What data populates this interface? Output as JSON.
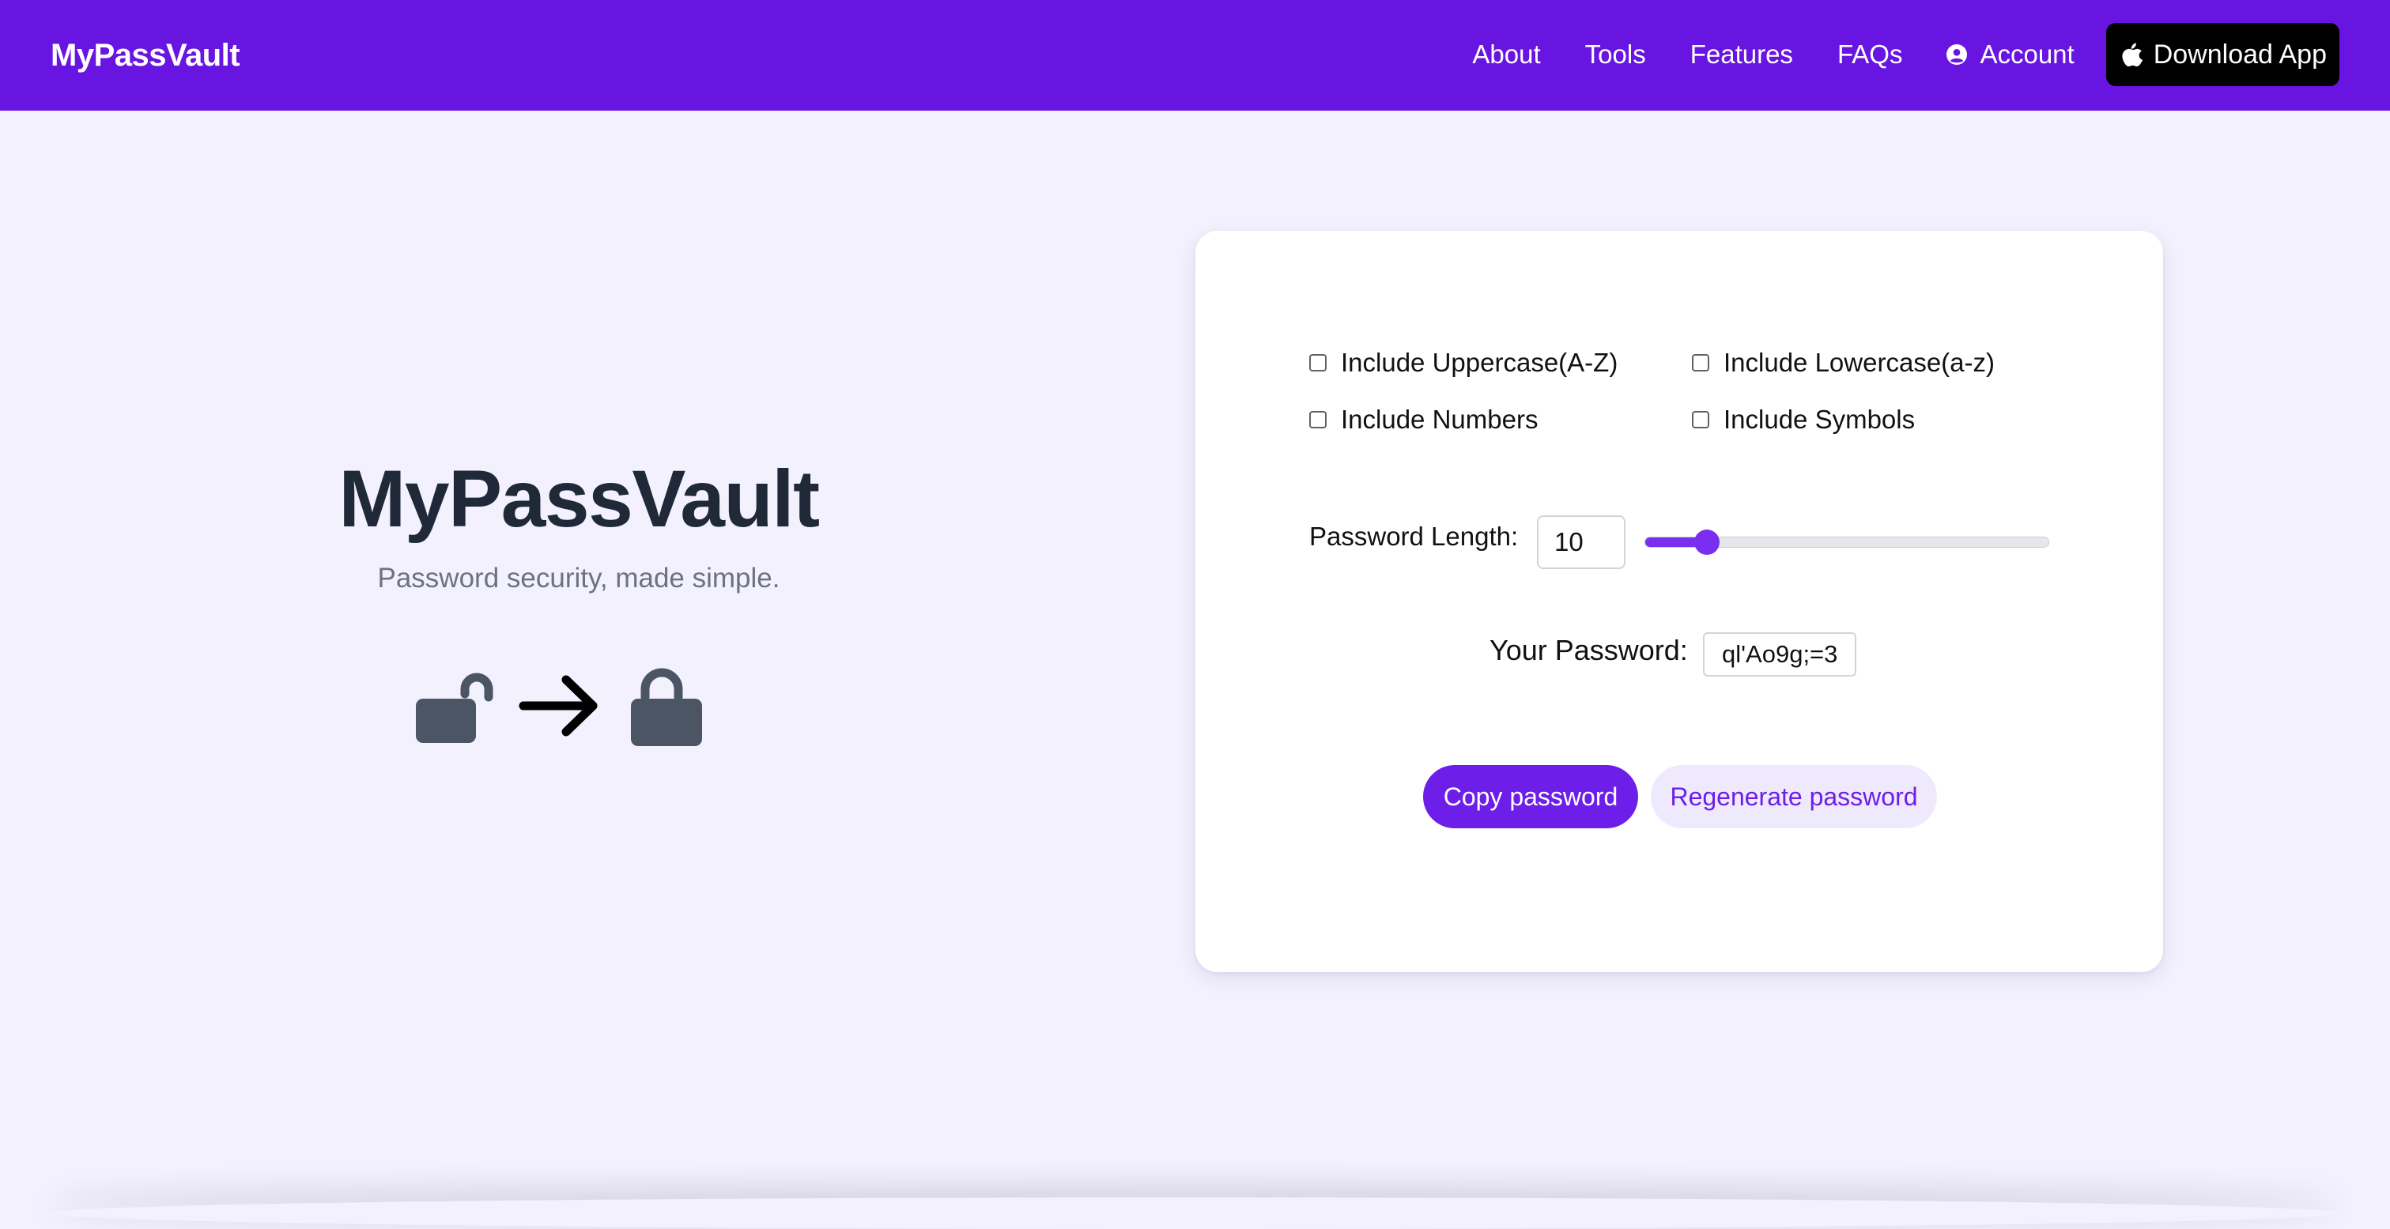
{
  "navbar": {
    "brand": "MyPassVault",
    "links": [
      {
        "label": "About"
      },
      {
        "label": "Tools"
      },
      {
        "label": "Features"
      },
      {
        "label": "FAQs"
      },
      {
        "label": "Account",
        "icon": "user-circle-icon"
      }
    ],
    "download_label": "Download App",
    "download_icon": "apple-icon"
  },
  "hero": {
    "title": "MyPassVault",
    "subtitle": "Password security, made simple.",
    "graphic_icons": [
      "unlocked-padlock-icon",
      "arrow-right-icon",
      "locked-padlock-icon"
    ]
  },
  "generator": {
    "options": {
      "uppercase": {
        "label": "Include Uppercase(A-Z)",
        "checked": false
      },
      "lowercase": {
        "label": "Include Lowercase(a-z)",
        "checked": false
      },
      "numbers": {
        "label": "Include Numbers",
        "checked": false
      },
      "symbols": {
        "label": "Include Symbols",
        "checked": false
      }
    },
    "length_label": "Password Length:",
    "length_value": "10",
    "slider": {
      "min": 6,
      "max": 32,
      "value": 10
    },
    "password_label": "Your Password:",
    "password_value": "ql'Ao9g;=3",
    "copy_label": "Copy password",
    "regenerate_label": "Regenerate password"
  },
  "colors": {
    "brand_purple": "#6915e2",
    "accent": "#7a2ff0",
    "page_background": "#f3f1fd",
    "hero_title": "#1f2937",
    "hero_subtitle": "#6b7280",
    "icon_gray": "#4b5563"
  }
}
